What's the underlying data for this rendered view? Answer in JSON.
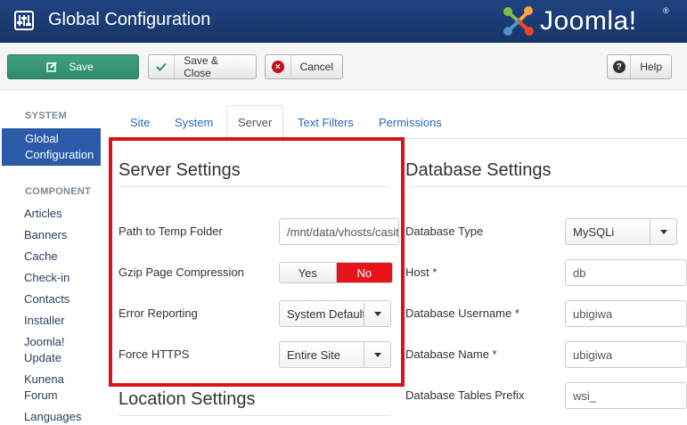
{
  "header": {
    "title": "Global Configuration",
    "logo_text": "Joomla!",
    "logo_mark": "®"
  },
  "toolbar": {
    "save": "Save",
    "save_close": "Save & Close",
    "cancel": "Cancel",
    "help": "Help"
  },
  "sidebar": {
    "system_heading": "SYSTEM",
    "active_item": [
      "Global",
      "Configuration"
    ],
    "component_heading": "COMPONENT",
    "items": [
      "Articles",
      "Banners",
      "Cache",
      "Check-in",
      "Contacts",
      "Installer",
      "Joomla!",
      "Update",
      "Kunena",
      "Forum",
      "Languages"
    ]
  },
  "tabs": [
    "Site",
    "System",
    "Server",
    "Text Filters",
    "Permissions"
  ],
  "server": {
    "title": "Server Settings",
    "temp_label": "Path to Temp Folder",
    "temp_value": "/mnt/data/vhosts/casit",
    "gzip_label": "Gzip Page Compression",
    "gzip_yes": "Yes",
    "gzip_no": "No",
    "error_label": "Error Reporting",
    "error_value": "System Default",
    "https_label": "Force HTTPS",
    "https_value": "Entire Site"
  },
  "location": {
    "title": "Location Settings"
  },
  "database": {
    "title": "Database Settings",
    "type_label": "Database Type",
    "type_value": "MySQLi",
    "host_label": "Host *",
    "host_value": "db",
    "user_label": "Database Username *",
    "user_value": "ubigiwa",
    "name_label": "Database Name *",
    "name_value": "ubigiwa",
    "prefix_label": "Database Tables Prefix",
    "prefix_value": "wsi_"
  },
  "colors": {
    "header": "#1c3d7a",
    "save": "#3b9a76",
    "active_nav": "#2a5aa8",
    "highlight": "#d6131b",
    "toggle_no": "#e8141b"
  }
}
